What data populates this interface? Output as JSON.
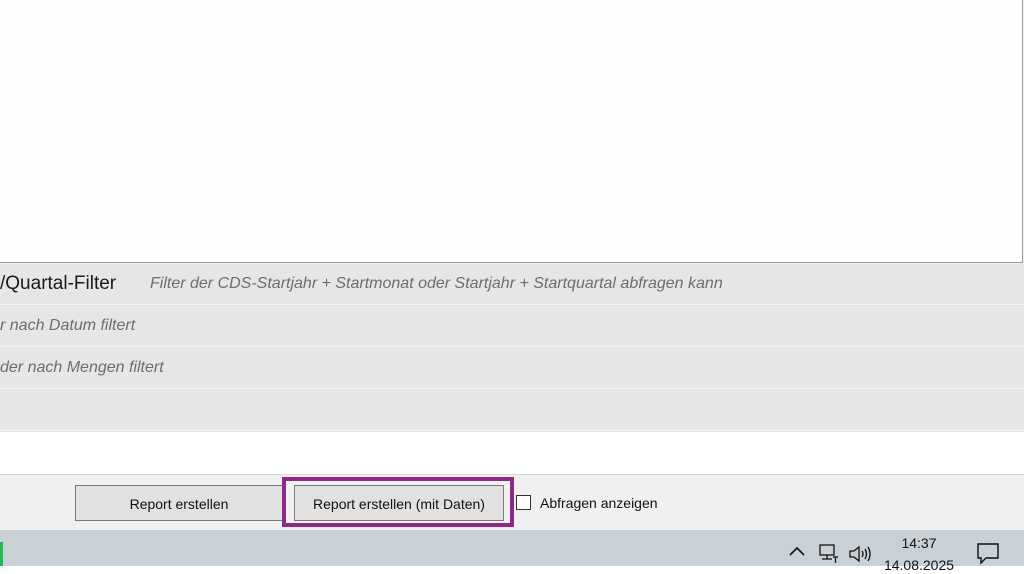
{
  "filters": [
    {
      "name": "/Quartal-Filter",
      "description": "Filter der CDS-Startjahr + Startmonat oder Startjahr + Startquartal abfragen kann"
    },
    {
      "name": "",
      "description": "r nach Datum filtert"
    },
    {
      "name": "",
      "description": "der nach Mengen filtert"
    },
    {
      "name": "",
      "description": ""
    }
  ],
  "actions": {
    "report_label": "Report erstellen",
    "report_with_data_label": "Report erstellen (mit Daten)",
    "show_queries_label": "Abfragen anzeigen",
    "show_queries_checked": false,
    "highlight_color": "#8e2a86"
  },
  "taskbar": {
    "time": "14:37",
    "date": "14.08.2025",
    "icons": [
      "chevron-up-icon",
      "network-icon",
      "volume-icon",
      "notification-icon"
    ]
  }
}
